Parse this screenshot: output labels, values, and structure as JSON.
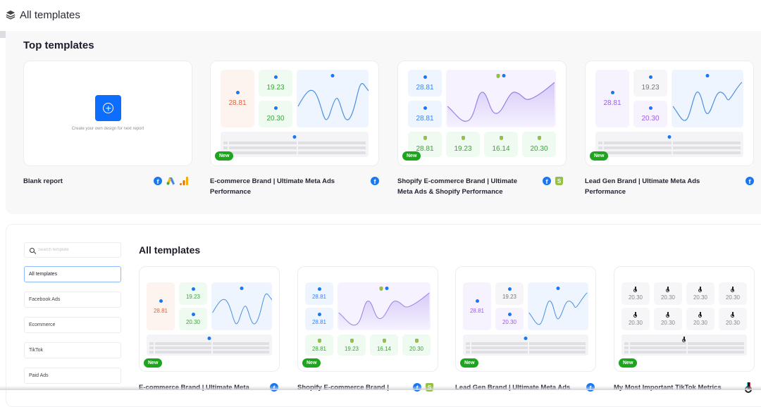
{
  "header": {
    "title": "All templates",
    "icon": "layers-icon"
  },
  "top_templates": {
    "heading": "Top templates",
    "blank": {
      "title": "Blank report",
      "hint": "Create your own design for next report",
      "icons": [
        "facebook-icon",
        "google-ads-icon",
        "google-analytics-icon"
      ]
    },
    "cards": [
      {
        "title": "E-commerce Brand | Ultimate Meta Ads Performance",
        "badge": "New",
        "icons": [
          "facebook-icon"
        ],
        "tiles": {
          "big": "28.81",
          "a": "19.23",
          "b": "20.30"
        }
      },
      {
        "title": "Shopify E-commerce Brand | Ultimate Meta Ads & Shopify Performance",
        "badge": "New",
        "icons": [
          "facebook-icon",
          "shopify-icon"
        ],
        "tiles": {
          "l1": "28.81",
          "l2": "28.81",
          "b1": "28.81",
          "b2": "19.23",
          "b3": "16.14",
          "b4": "20.30"
        }
      },
      {
        "title": "Lead Gen Brand | Ultimate Meta Ads Performance",
        "badge": "New",
        "icons": [
          "facebook-icon"
        ],
        "tiles": {
          "big": "28.81",
          "a": "19.23",
          "b": "20.30"
        }
      }
    ]
  },
  "all_templates": {
    "heading": "All templates",
    "search": {
      "placeholder": "Search template",
      "value": ""
    },
    "filters": [
      "All templates",
      "Facebook Ads",
      "Ecommerce",
      "TikTok",
      "Paid Ads"
    ],
    "active_filter": "All templates",
    "cards": [
      {
        "title": "E-commerce Brand | Ultimate Meta",
        "badge": "New",
        "icons": [
          "facebook-icon"
        ],
        "tiles": {
          "big": "28.81",
          "a": "19.23",
          "b": "20.30"
        }
      },
      {
        "title": "Shopify E-commerce Brand |",
        "badge": "New",
        "icons": [
          "facebook-icon",
          "shopify-icon"
        ],
        "tiles": {
          "l1": "28.81",
          "l2": "28.81",
          "b1": "28.81",
          "b2": "19.23",
          "b3": "16.14",
          "b4": "20.30"
        }
      },
      {
        "title": "Lead Gen Brand | Ultimate Meta Ads",
        "badge": "New",
        "icons": [
          "facebook-icon"
        ],
        "tiles": {
          "big": "28.81",
          "a": "19.23",
          "b": "20.30"
        }
      },
      {
        "title": "My Most Important TikTok Metrics",
        "badge": "New",
        "icons": [
          "tiktok-icon"
        ],
        "tiles": [
          "20.30",
          "20.30",
          "20.30",
          "20.30",
          "20.30",
          "20.30",
          "20.30",
          "20.30"
        ]
      }
    ]
  },
  "colors": {
    "accent": "#0d6efd",
    "new_badge": "#1ea51e",
    "facebook": "#1877f2",
    "shopify": "#95bf47"
  }
}
